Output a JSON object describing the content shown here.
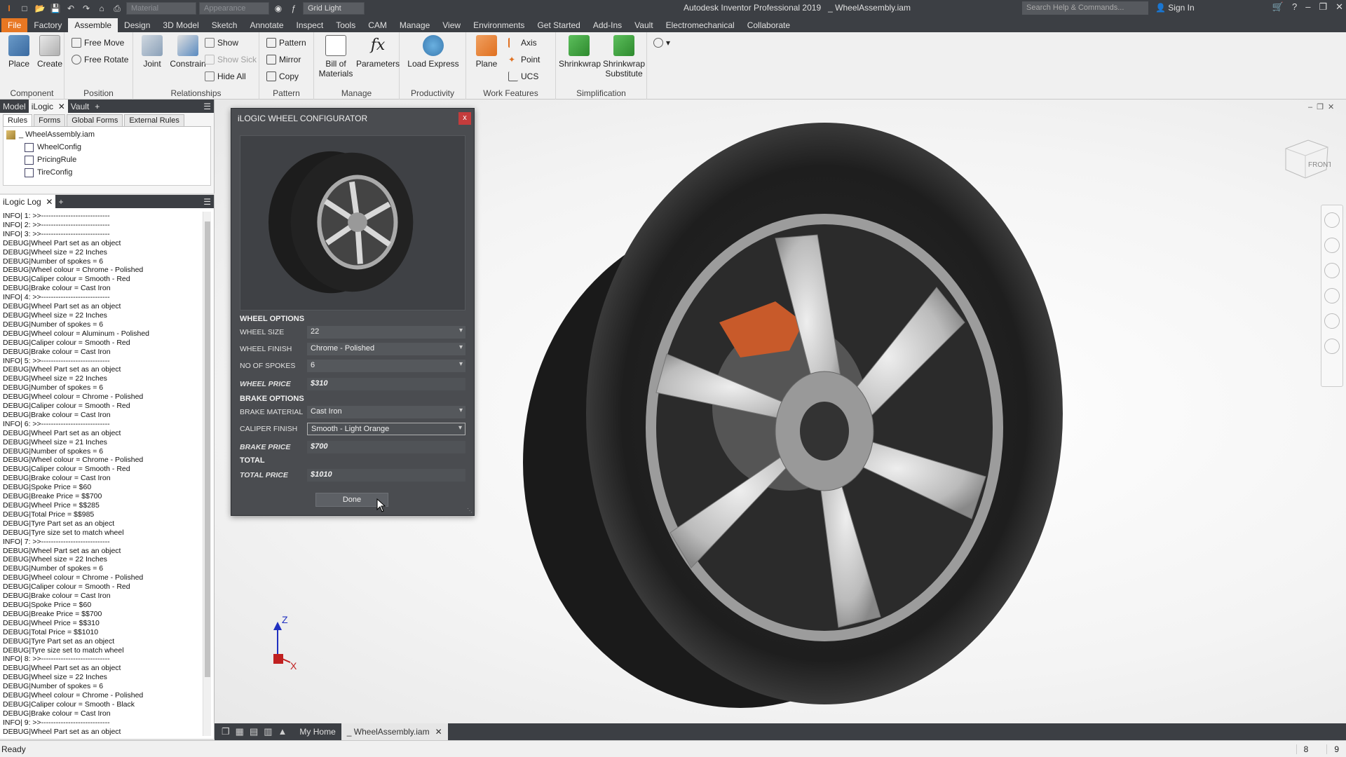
{
  "titlebar": {
    "app_title": "Autodesk Inventor Professional 2019",
    "doc_title": "_ WheelAssembly.iam",
    "material_placeholder": "Material",
    "appearance_placeholder": "Appearance",
    "lighting": "Grid Light",
    "search_placeholder": "Search Help & Commands...",
    "sign_in": "Sign In"
  },
  "ribbon_tabs": [
    "File",
    "Factory",
    "Assemble",
    "Design",
    "3D Model",
    "Sketch",
    "Annotate",
    "Inspect",
    "Tools",
    "CAM",
    "Manage",
    "View",
    "Environments",
    "Get Started",
    "Add-Ins",
    "Vault",
    "Electromechanical",
    "Collaborate"
  ],
  "ribbon": {
    "place": "Place",
    "create": "Create",
    "free_move": "Free Move",
    "free_rotate": "Free Rotate",
    "joint": "Joint",
    "constrain": "Constrain",
    "show": "Show",
    "show_sick": "Show Sick",
    "hide_all": "Hide All",
    "pattern": "Pattern",
    "mirror": "Mirror",
    "copy": "Copy",
    "bom_line1": "Bill of",
    "bom_line2": "Materials",
    "parameters": "Parameters",
    "load_express": "Load Express",
    "plane": "Plane",
    "axis": "Axis",
    "point": "Point",
    "ucs": "UCS",
    "shrinkwrap": "Shrinkwrap",
    "shrinkwrap_sub1": "Shrinkwrap",
    "shrinkwrap_sub2": "Substitute",
    "panels": {
      "component": "Component",
      "position": "Position",
      "relationships": "Relationships",
      "pattern": "Pattern",
      "manage": "Manage",
      "productivity": "Productivity",
      "work_features": "Work Features",
      "simplification": "Simplification"
    }
  },
  "browser": {
    "tabs": [
      "Model",
      "iLogic",
      "Vault"
    ],
    "subtabs": [
      "Rules",
      "Forms",
      "Global Forms",
      "External Rules"
    ],
    "root": "_ WheelAssembly.iam",
    "rules": [
      "WheelConfig",
      "PricingRule",
      "TireConfig"
    ]
  },
  "log": {
    "tab": "iLogic Log",
    "lines": [
      "INFO| 1: >>----------------------------",
      "INFO| 2: >>----------------------------",
      "INFO| 3: >>----------------------------",
      "DEBUG|Wheel Part set as an object",
      "DEBUG|Wheel size = 22 Inches",
      "DEBUG|Number of spokes = 6",
      "DEBUG|Wheel colour = Chrome - Polished",
      "DEBUG|Caliper colour = Smooth - Red",
      "DEBUG|Brake colour = Cast Iron",
      "INFO| 4: >>----------------------------",
      "DEBUG|Wheel Part set as an object",
      "DEBUG|Wheel size = 22 Inches",
      "DEBUG|Number of spokes = 6",
      "DEBUG|Wheel colour = Aluminum - Polished",
      "DEBUG|Caliper colour = Smooth - Red",
      "DEBUG|Brake colour = Cast Iron",
      "INFO| 5: >>----------------------------",
      "DEBUG|Wheel Part set as an object",
      "DEBUG|Wheel size = 22 Inches",
      "DEBUG|Number of spokes = 6",
      "DEBUG|Wheel colour = Chrome - Polished",
      "DEBUG|Caliper colour = Smooth - Red",
      "DEBUG|Brake colour = Cast Iron",
      "INFO| 6: >>----------------------------",
      "DEBUG|Wheel Part set as an object",
      "DEBUG|Wheel size = 21 Inches",
      "DEBUG|Number of spokes = 6",
      "DEBUG|Wheel colour = Chrome - Polished",
      "DEBUG|Caliper colour = Smooth - Red",
      "DEBUG|Brake colour = Cast Iron",
      "DEBUG|Spoke Price = $60",
      "DEBUG|Breake Price = $$700",
      "DEBUG|Wheel Price = $$285",
      "DEBUG|Total Price = $$985",
      "DEBUG|Tyre Part set as an object",
      "DEBUG|Tyre size set to match wheel",
      "INFO| 7: >>----------------------------",
      "DEBUG|Wheel Part set as an object",
      "DEBUG|Wheel size = 22 Inches",
      "DEBUG|Number of spokes = 6",
      "DEBUG|Wheel colour = Chrome - Polished",
      "DEBUG|Caliper colour = Smooth - Red",
      "DEBUG|Brake colour = Cast Iron",
      "DEBUG|Spoke Price = $60",
      "DEBUG|Breake Price = $$700",
      "DEBUG|Wheel Price = $$310",
      "DEBUG|Total Price = $$1010",
      "DEBUG|Tyre Part set as an object",
      "DEBUG|Tyre size set to match wheel",
      "INFO| 8: >>----------------------------",
      "DEBUG|Wheel Part set as an object",
      "DEBUG|Wheel size = 22 Inches",
      "DEBUG|Number of spokes = 6",
      "DEBUG|Wheel colour = Chrome - Polished",
      "DEBUG|Caliper colour = Smooth - Black",
      "DEBUG|Brake colour = Cast Iron",
      "INFO| 9: >>----------------------------",
      "DEBUG|Wheel Part set as an object"
    ]
  },
  "dialog": {
    "title": "iLOGIC WHEEL CONFIGURATOR",
    "close": "x",
    "wheel_options": "WHEEL OPTIONS",
    "wheel_size_label": "WHEEL SIZE",
    "wheel_size": "22",
    "wheel_finish_label": "WHEEL FINISH",
    "wheel_finish": "Chrome - Polished",
    "spokes_label": "NO OF SPOKES",
    "spokes": "6",
    "wheel_price_label": "WHEEL PRICE",
    "wheel_price": "$310",
    "brake_options": "BRAKE OPTIONS",
    "brake_material_label": "BRAKE MATERIAL",
    "brake_material": "Cast Iron",
    "caliper_finish_label": "CALIPER FINISH",
    "caliper_finish": "Smooth - Light Orange",
    "brake_price_label": "BRAKE PRICE",
    "brake_price": "$700",
    "total": "TOTAL",
    "total_price_label": "TOTAL PRICE",
    "total_price": "$1010",
    "done": "Done"
  },
  "viewcube": {
    "face": "FRONT"
  },
  "triad": {
    "z": "Z",
    "x": "X"
  },
  "doctabs": {
    "home": "My Home",
    "doc": "_ WheelAssembly.iam"
  },
  "status": {
    "text": "Ready",
    "n1": "8",
    "n2": "9"
  },
  "colors": {
    "accent": "#e87722",
    "caliper": "#c85a2a",
    "dialog_bg": "#4a4c50",
    "chrome_bg": "#3c3f44"
  }
}
